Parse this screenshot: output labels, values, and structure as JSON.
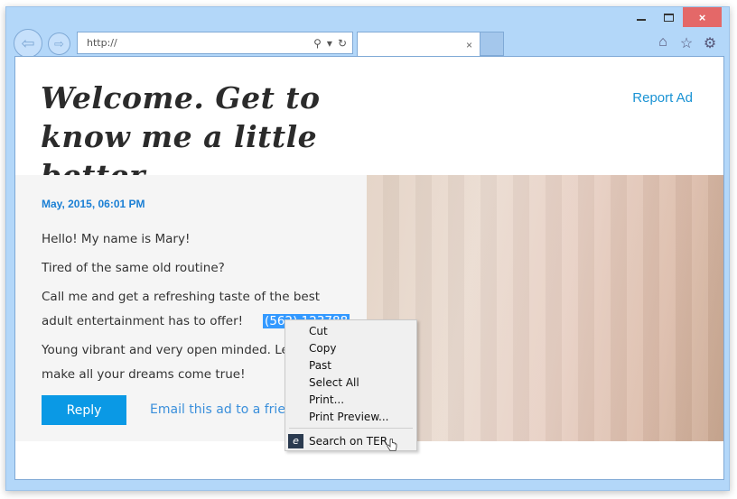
{
  "browser": {
    "url": "http://",
    "tab_close_glyph": "×",
    "window_controls": {
      "minimize": "",
      "maximize": "",
      "close": "×"
    },
    "nav": {
      "back_glyph": "⇦",
      "forward_glyph": "⇨"
    },
    "address_icons": {
      "search": "⚲",
      "dropdown": "▾",
      "refresh": "↻"
    },
    "toolbar_icons": {
      "home": "⌂",
      "favorites": "☆",
      "settings": "⚙"
    },
    "colors": {
      "frame": "#b3d7f9",
      "close_button": "#e46868"
    }
  },
  "page": {
    "headline": "Welcome. Get to know me a little better...",
    "report_ad": "Report Ad",
    "post": {
      "date": "May, 2015, 06:01 PM",
      "paragraphs": {
        "p1": "Hello! My name is Mary!",
        "p2": "Tired of the same old routine?",
        "p3": "Call me and get a refreshing taste of the best adult entertainment has to offer!",
        "phone": "(562) 123788",
        "p4": "Young vibrant and very open minded. Let me make all your dreams come true!"
      }
    },
    "reply_button": "Reply",
    "email_link": "Email this ad to a friend",
    "photo_alt": "photo",
    "colors": {
      "accent": "#0a99e5",
      "link": "#1a93d4",
      "selection": "#3399ff"
    }
  },
  "context_menu": {
    "items": [
      {
        "label": "Cut"
      },
      {
        "label": "Copy"
      },
      {
        "label": "Past"
      },
      {
        "label": "Select All"
      },
      {
        "label": "Print..."
      },
      {
        "label": "Print Preview..."
      }
    ],
    "extension_item": {
      "label": "Search on TER",
      "icon_glyph": "e"
    }
  }
}
